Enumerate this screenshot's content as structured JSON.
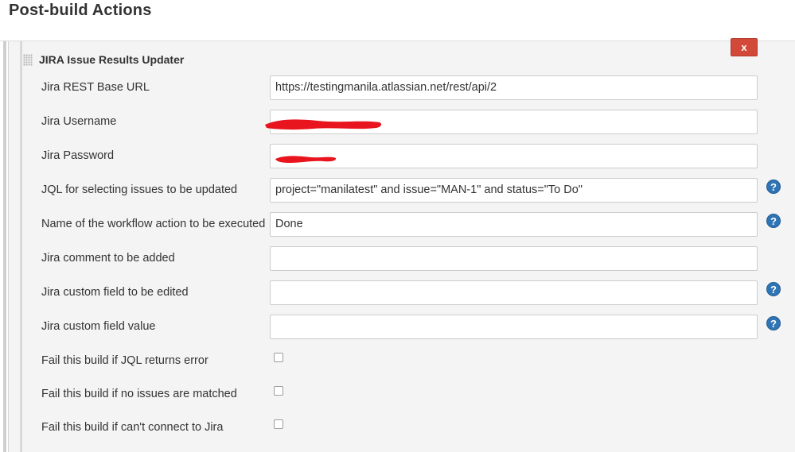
{
  "section": {
    "title": "Post-build Actions"
  },
  "panel": {
    "title": "JIRA Issue Results Updater",
    "delete_label": "x",
    "colors": {
      "delete": "#d24939",
      "help": "#2f74b5",
      "redaction": "#e8141e"
    }
  },
  "fields": [
    {
      "label": "Jira REST Base URL",
      "value": "https://testingmanila.atlassian.net/rest/api/2",
      "help": false
    },
    {
      "label": "Jira Username",
      "value": "",
      "redacted": true,
      "help": false
    },
    {
      "label": "Jira Password",
      "value": "",
      "redacted": true,
      "help": false
    },
    {
      "label": "JQL for selecting issues to be updated",
      "value": "project=\"manilatest\" and issue=\"MAN-1\" and status=\"To Do\"",
      "help": true
    },
    {
      "label": "Name of the workflow action to be executed",
      "value": "Done",
      "help": true
    },
    {
      "label": "Jira comment to be added",
      "value": "",
      "help": false
    },
    {
      "label": "Jira custom field to be edited",
      "value": "",
      "help": true
    },
    {
      "label": "Jira custom field value",
      "value": "",
      "help": true
    }
  ],
  "checkboxes": [
    {
      "label": "Fail this build if JQL returns error",
      "checked": false
    },
    {
      "label": "Fail this build if no issues are matched",
      "checked": false
    },
    {
      "label": "Fail this build if can't connect to Jira",
      "checked": false
    }
  ],
  "icons": {
    "help": "question-mark-icon",
    "drag": "drag-handle-icon",
    "delete": "close-icon"
  }
}
